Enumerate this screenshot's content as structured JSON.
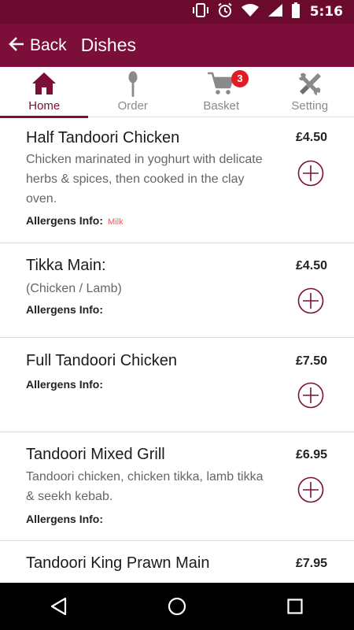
{
  "status_bar": {
    "time": "5:16"
  },
  "app_bar": {
    "back_label": "Back",
    "title": "Dishes"
  },
  "tabs": [
    {
      "label": "Home",
      "icon": "home-icon",
      "active": true
    },
    {
      "label": "Order",
      "icon": "spoon-icon",
      "active": false
    },
    {
      "label": "Basket",
      "icon": "cart-icon",
      "active": false,
      "badge": "3"
    },
    {
      "label": "Setting",
      "icon": "tools-icon",
      "active": false
    }
  ],
  "dishes": [
    {
      "name": "Half Tandoori Chicken",
      "price": "£4.50",
      "description": "Chicken marinated in yoghurt with delicate herbs & spices, then cooked in the clay oven.",
      "allergens_label": "Allergens Info:",
      "allergens": "Milk"
    },
    {
      "name": "Tikka Main:",
      "price": "£4.50",
      "description": "(Chicken / Lamb)",
      "allergens_label": "Allergens Info:",
      "allergens": ""
    },
    {
      "name": "Full Tandoori Chicken",
      "price": "£7.50",
      "description": "",
      "allergens_label": "Allergens Info:",
      "allergens": ""
    },
    {
      "name": "Tandoori Mixed Grill",
      "price": "£6.95",
      "description": "Tandoori chicken, chicken tikka, lamb tikka & seekh kebab.",
      "allergens_label": "Allergens Info:",
      "allergens": ""
    },
    {
      "name": "Tandoori King Prawn Main",
      "price": "£7.95",
      "description": "",
      "allergens_label": "",
      "allergens": ""
    }
  ],
  "colors": {
    "primary": "#7b0f3a",
    "status_bar": "#6b0a2c",
    "badge": "#e01c24",
    "allergen": "#e66060"
  }
}
